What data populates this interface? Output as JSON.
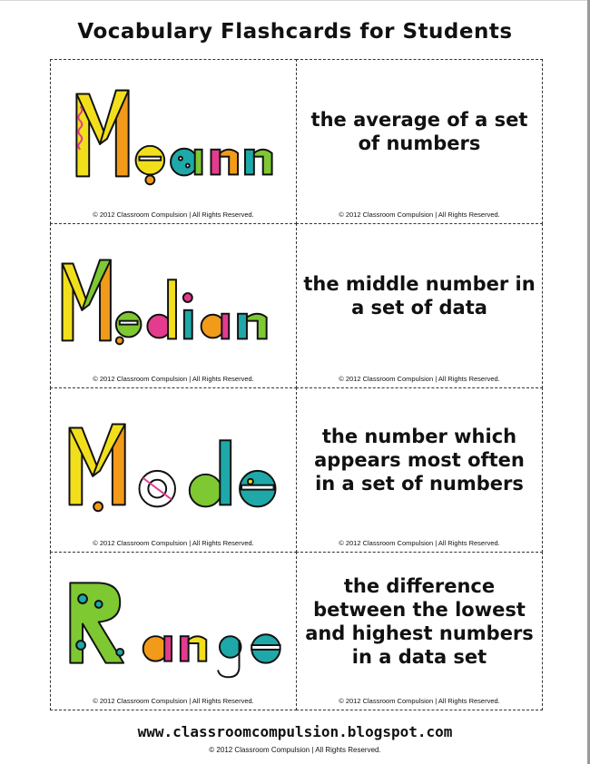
{
  "title": "Vocabulary Flashcards for Students",
  "cards": [
    {
      "word": "Mean",
      "definition": "the average of a set of numbers",
      "copyright_left": "© 2012 Classroom Compulsion | All Rights Reserved.",
      "copyright_right": "© 2012 Classroom Compulsion | All Rights Reserved."
    },
    {
      "word": "Median",
      "definition": "the middle number in a set of data",
      "copyright_left": "© 2012 Classroom Compulsion | All Rights Reserved.",
      "copyright_right": "© 2012 Classroom Compulsion | All Rights Reserved."
    },
    {
      "word": "Mode",
      "definition": "the number which appears most often in a set of numbers",
      "copyright_left": "© 2012 Classroom Compulsion | All Rights Reserved.",
      "copyright_right": "© 2012 Classroom Compulsion | All Rights Reserved."
    },
    {
      "word": "Range",
      "definition": "the difference between the lowest and highest numbers in a data set",
      "copyright_left": "© 2012 Classroom Compulsion | All Rights Reserved.",
      "copyright_right": "© 2012 Classroom Compulsion | All Rights Reserved."
    }
  ],
  "footer": {
    "url": "www.classroomcompulsion.blogspot.com",
    "copyright": "© 2012 Classroom Compulsion | All Rights Reserved."
  },
  "colors": {
    "yellow": "#f2df1c",
    "orange": "#f29a1a",
    "green": "#7ec832",
    "teal": "#1ea9a8",
    "pink": "#e43b8f",
    "outline": "#111111"
  }
}
